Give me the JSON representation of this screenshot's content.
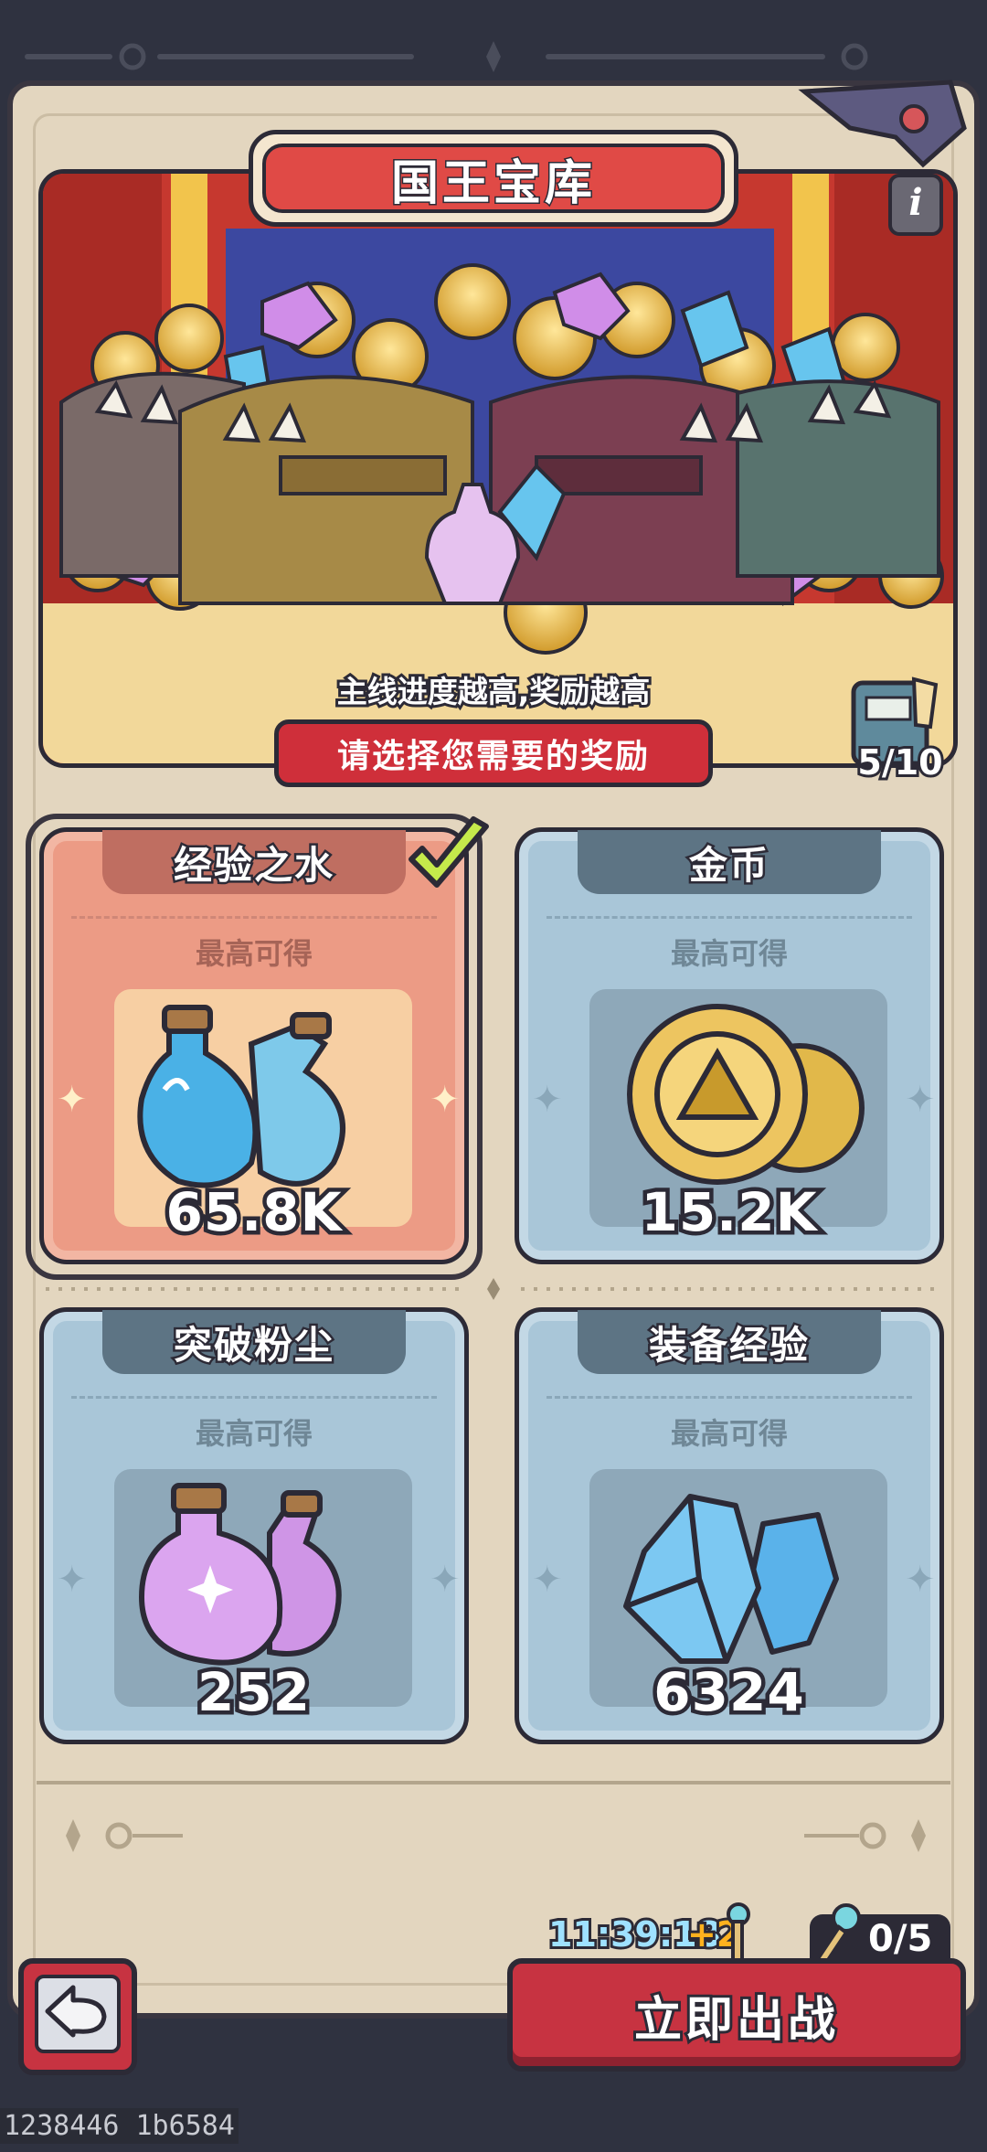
{
  "title": "国王宝库",
  "info_icon": "info-icon",
  "banner": {
    "subtitle": "主线进度越高,奖励越高",
    "select_prompt": "请选择您需要的奖励",
    "book_count": "5/10"
  },
  "rewards": [
    {
      "name": "经验之水",
      "sub": "最高可得",
      "value": "65.8K",
      "icon": "blue-potion-icon",
      "selected": true
    },
    {
      "name": "金币",
      "sub": "最高可得",
      "value": "15.2K",
      "icon": "gold-coin-icon",
      "selected": false
    },
    {
      "name": "突破粉尘",
      "sub": "最高可得",
      "value": "252",
      "icon": "purple-potion-icon",
      "selected": false
    },
    {
      "name": "装备经验",
      "sub": "最高可得",
      "value": "6324",
      "icon": "blue-crystal-icon",
      "selected": false
    }
  ],
  "footer": {
    "timer": "11:39:18",
    "timer_bonus": "+2",
    "keys": "0/5",
    "fight_label": "立即出战"
  },
  "debug_text": "1238446 1b6584",
  "colors": {
    "panel": "#e3d6bf",
    "card_blue": "#a9c6d8",
    "card_selected": "#ec9b85",
    "button_red": "#c73341",
    "outline": "#2c2a36"
  }
}
